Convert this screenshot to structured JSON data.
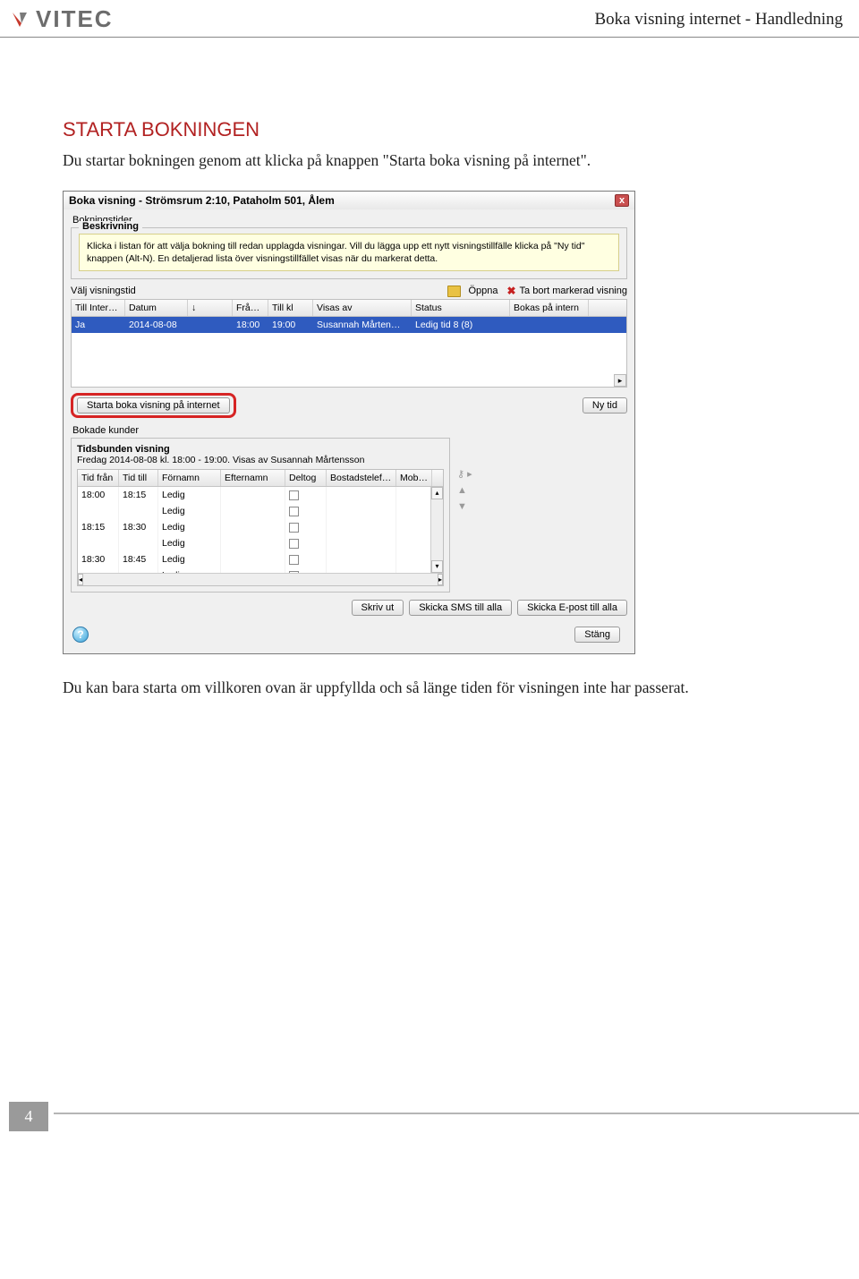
{
  "header": {
    "brand": "VITEC",
    "doc_title": "Boka visning internet - Handledning"
  },
  "section": {
    "heading": "STARTA BOKNINGEN",
    "intro": "Du startar bokningen genom att klicka på knappen \"Starta boka visning på internet\".",
    "outro": "Du kan bara starta om villkoren ovan är uppfyllda och så länge tiden för visningen inte har passerat."
  },
  "dialog": {
    "title": "Boka visning - Strömsrum 2:10, Pataholm 501, Ålem",
    "group_bokningstider": "Bokningstider",
    "desc_legend": "Beskrivning",
    "desc_text": "Klicka i listan för att välja bokning till redan upplagda visningar. Vill du lägga upp ett nytt visningstillfälle klicka på \"Ny tid\" knappen (Alt-N). En detaljerad lista över visningstillfället visas när du markerat detta.",
    "toolbar": {
      "left": "Välj visningstid",
      "open": "Öppna",
      "delete": "Ta bort markerad visning"
    },
    "grid1": {
      "cols": [
        "Till Internet",
        "Datum",
        "↓",
        "Från kl",
        "Till kl",
        "Visas av",
        "Status",
        "Bokas på intern"
      ],
      "row": [
        "Ja",
        "2014-08-08",
        "",
        "18:00",
        "19:00",
        "Susannah Mårten…",
        "Ledig tid 8 (8)",
        ""
      ]
    },
    "btn_start": "Starta boka visning på internet",
    "btn_nytid": "Ny tid",
    "group_bokade": "Bokade kunder",
    "bk_title": "Tidsbunden visning",
    "bk_sub": "Fredag 2014-08-08 kl. 18:00 - 19:00. Visas av Susannah Mårtensson",
    "grid2": {
      "cols": [
        "Tid från",
        "Tid till",
        "Förnamn",
        "Efternamn",
        "Deltog",
        "Bostadstelefon",
        "Mobiltel"
      ],
      "rows": [
        [
          "18:00",
          "18:15",
          "Ledig",
          "",
          "chk",
          "",
          ""
        ],
        [
          "",
          "",
          "Ledig",
          "",
          "chk",
          "",
          ""
        ],
        [
          "18:15",
          "18:30",
          "Ledig",
          "",
          "chk",
          "",
          ""
        ],
        [
          "",
          "",
          "Ledig",
          "",
          "chk",
          "",
          ""
        ],
        [
          "18:30",
          "18:45",
          "Ledig",
          "",
          "chk",
          "",
          ""
        ],
        [
          "",
          "",
          "Ledig",
          "",
          "chk",
          "",
          ""
        ]
      ]
    },
    "btn_skrivut": "Skriv ut",
    "btn_sms": "Skicka SMS till alla",
    "btn_epost": "Skicka E-post till alla",
    "btn_stang": "Stäng",
    "help": "?"
  },
  "page_number": "4"
}
